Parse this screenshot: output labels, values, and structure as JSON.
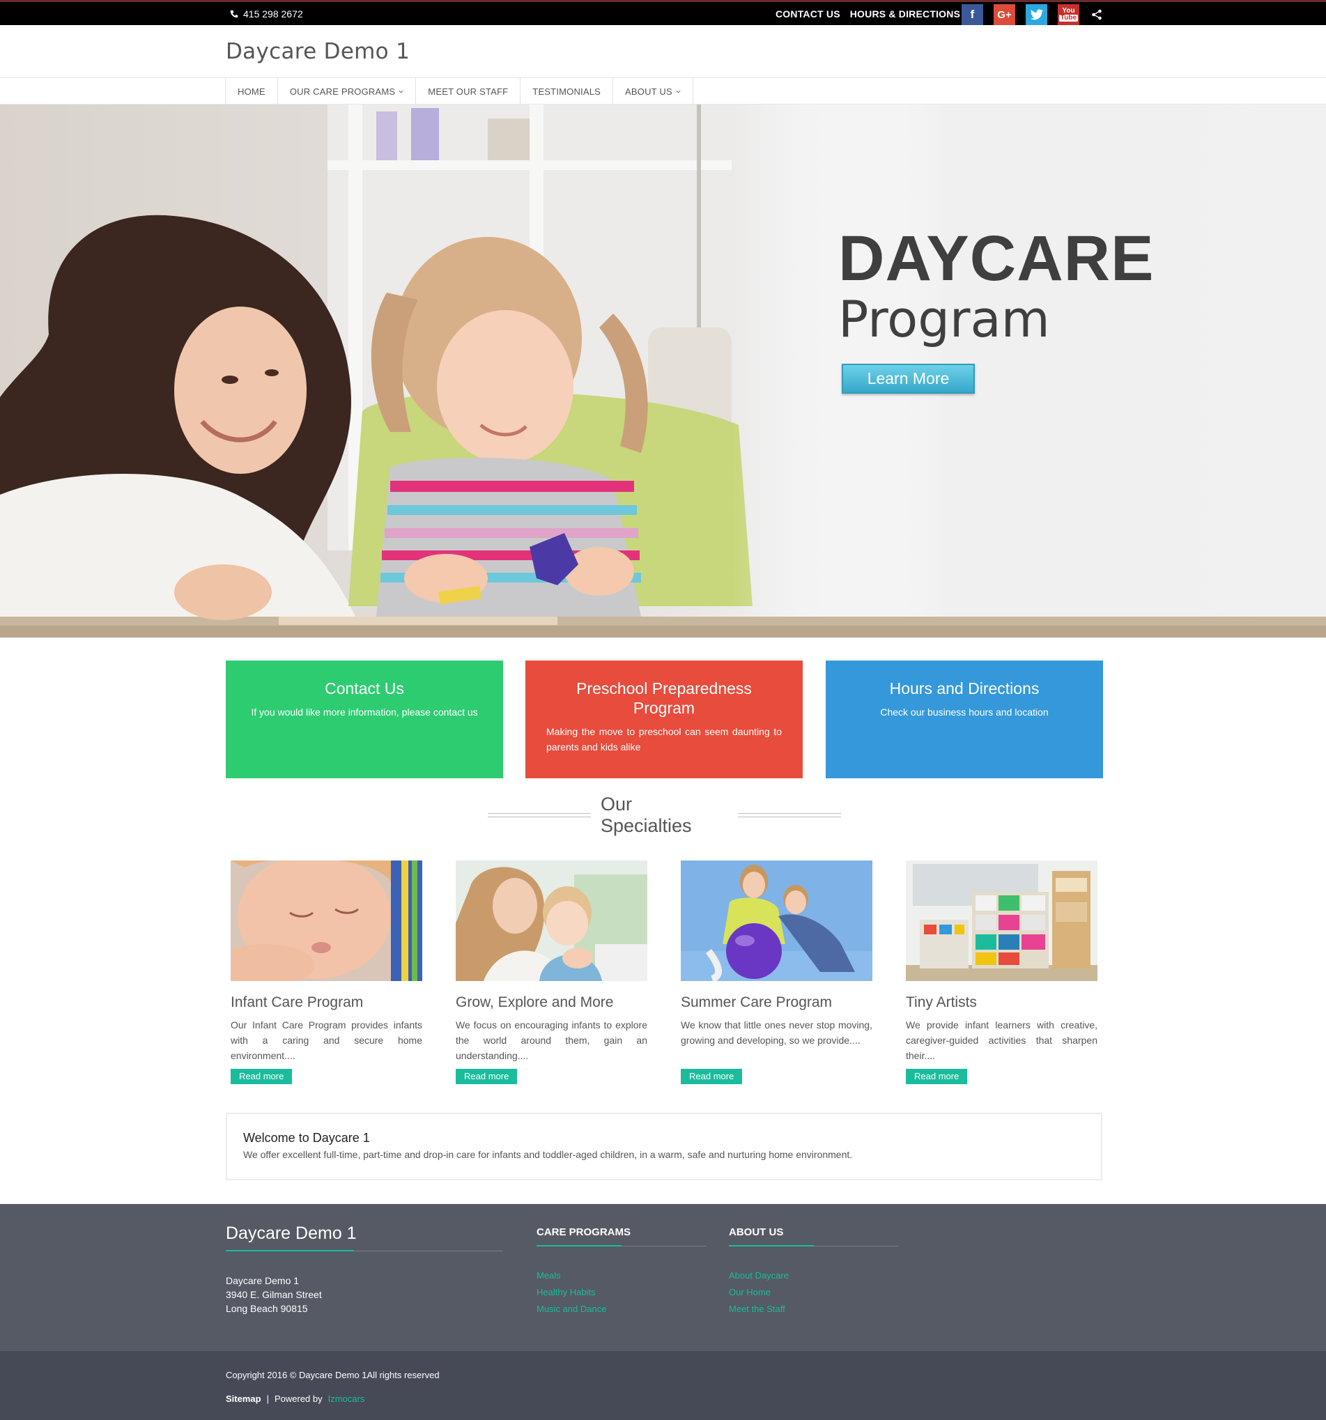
{
  "topbar": {
    "phone": "415 298 2672",
    "links": [
      "CONTACT US",
      "HOURS & DIRECTIONS"
    ],
    "social": {
      "facebook": "f",
      "google_plus": "G+",
      "twitter": "twitter-icon",
      "youtube": "You Tube",
      "share": "share-icon"
    },
    "colors": {
      "facebook": "#3b5998",
      "google_plus": "#dd4b39",
      "twitter": "#2aa8e0",
      "youtube": "#c4302b"
    }
  },
  "header": {
    "site_title": "Daycare Demo 1",
    "nav": [
      {
        "label": "HOME",
        "has_dropdown": false
      },
      {
        "label": "OUR CARE PROGRAMS",
        "has_dropdown": true
      },
      {
        "label": "MEET OUR STAFF",
        "has_dropdown": false
      },
      {
        "label": "TESTIMONIALS",
        "has_dropdown": false
      },
      {
        "label": "ABOUT US",
        "has_dropdown": true
      }
    ]
  },
  "hero": {
    "title": "DAYCARE",
    "subtitle": "Program",
    "button": "Learn More",
    "button_color": "#35a9ca"
  },
  "features": [
    {
      "title": "Contact Us",
      "text": "If you would like more information, please contact us",
      "color": "#2ecc71"
    },
    {
      "title": "Preschool Preparedness Program",
      "text": "Making the move to preschool can seem daunting to parents and kids alike",
      "color": "#e74c3c"
    },
    {
      "title": "Hours and Directions",
      "text": "Check our business hours and location",
      "color": "#3498db"
    }
  ],
  "specialties": {
    "heading": "Our Specialties",
    "items": [
      {
        "title": "Infant Care Program",
        "text": "Our Infant Care Program provides infants with a caring and secure home environment....",
        "button": "Read more"
      },
      {
        "title": "Grow, Explore and More",
        "text": "We focus on encouraging infants to explore the world around them, gain an understanding....",
        "button": "Read more"
      },
      {
        "title": "Summer Care Program",
        "text": "We know that little ones never stop moving, growing and developing, so we provide....",
        "button": "Read more"
      },
      {
        "title": "Tiny Artists",
        "text": "We provide infant learners with creative, caregiver-guided activities that sharpen their....",
        "button": "Read more"
      }
    ]
  },
  "welcome": {
    "title": "Welcome to Daycare 1",
    "text": "We offer excellent full-time, part-time and drop-in care for infants and toddler-aged children, in a warm, safe and nurturing home environment."
  },
  "footer": {
    "brand": "Daycare Demo 1",
    "address": [
      "Daycare Demo 1",
      "3940 E. Gilman Street",
      "Long Beach 90815"
    ],
    "care_programs": {
      "heading": "CARE PROGRAMS",
      "links": [
        "Meals",
        "Healthy Habits",
        "Music and Dance"
      ]
    },
    "about_us": {
      "heading": "ABOUT US",
      "links": [
        "About Daycare",
        "Our Home",
        "Meet the Staff"
      ]
    },
    "accent": "#1abc9c",
    "copyright": "Copyright 2016 © Daycare Demo 1All rights reserved",
    "sitemap": "Sitemap",
    "separator": "|",
    "powered_by": "Powered by",
    "powered_by_link": "Izmocars"
  }
}
